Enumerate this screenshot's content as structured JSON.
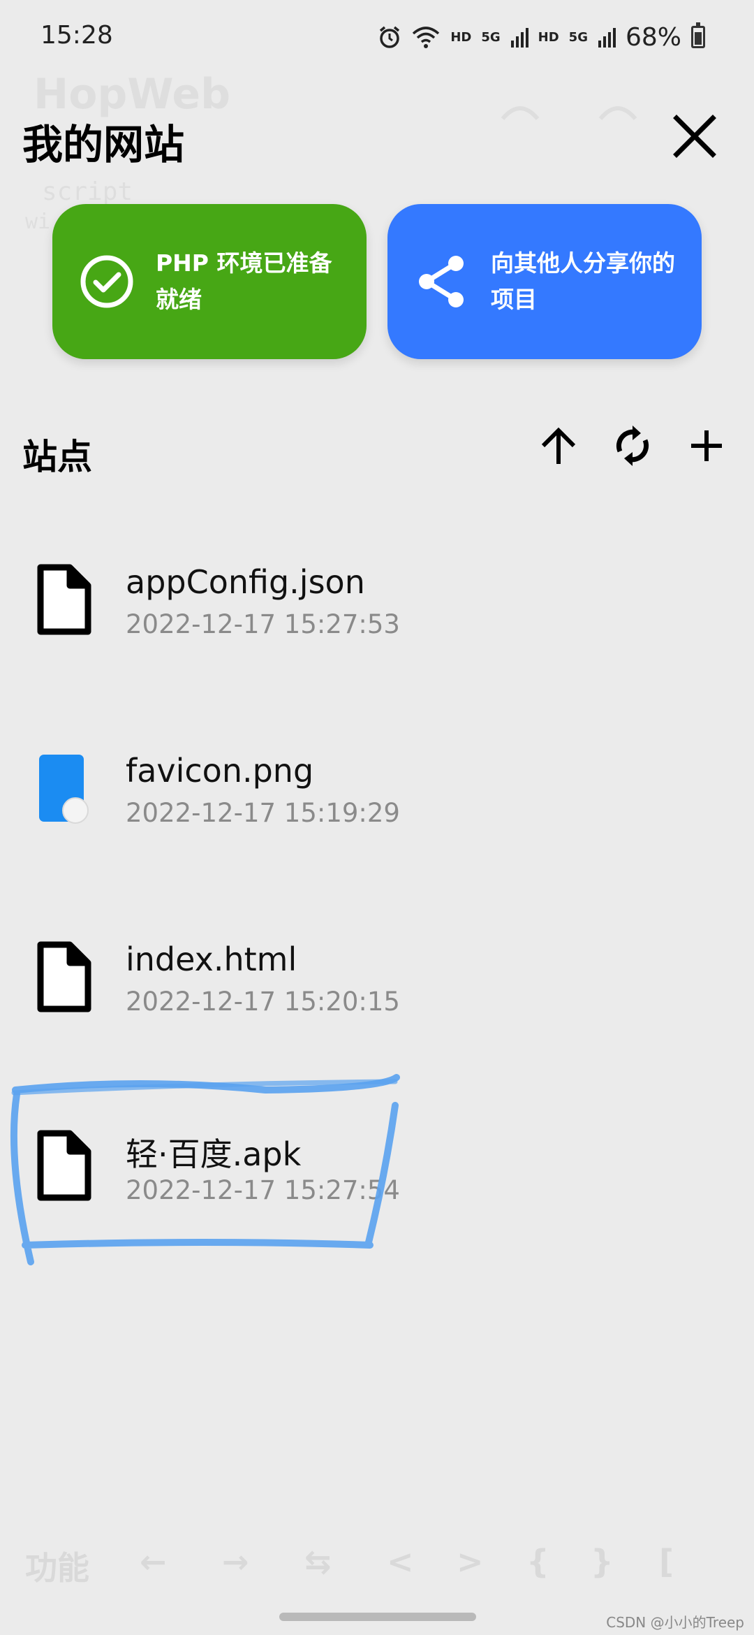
{
  "status_bar": {
    "time": "15:28",
    "hd1": "HD",
    "net1": "5G",
    "hd2": "HD",
    "net2": "5G",
    "battery": "68%",
    "battery_level": 0.68
  },
  "background": {
    "app_title": "HopWeb",
    "code_line_1": "script",
    "code_line_2": "wi",
    "bottom_toolbar": [
      "功能",
      "←",
      "→",
      "⇆",
      "<",
      ">",
      "{",
      "}",
      "["
    ]
  },
  "header": {
    "title": "我的网站"
  },
  "cards": {
    "php_status": "PHP 环境已准备就绪",
    "share": "向其他人分享你的项目"
  },
  "sites": {
    "title": "站点",
    "files": [
      {
        "name": "appConfig.json",
        "date": "2022-12-17 15:27:53",
        "icon": "document-icon"
      },
      {
        "name": "favicon.png",
        "date": "2022-12-17 15:19:29",
        "icon": "image-file-icon"
      },
      {
        "name": "index.html",
        "date": "2022-12-17 15:20:15",
        "icon": "document-icon"
      },
      {
        "name": "轻·百度.apk",
        "date": "2022-12-17 15:27:54",
        "icon": "document-icon"
      }
    ]
  },
  "colors": {
    "background": "#ebebeb",
    "green_card": "#47a715",
    "blue_card": "#3479ff",
    "date_text": "#8a8a8a",
    "annotation": "#5aa2f0"
  },
  "watermark": "CSDN @小小的Treep"
}
